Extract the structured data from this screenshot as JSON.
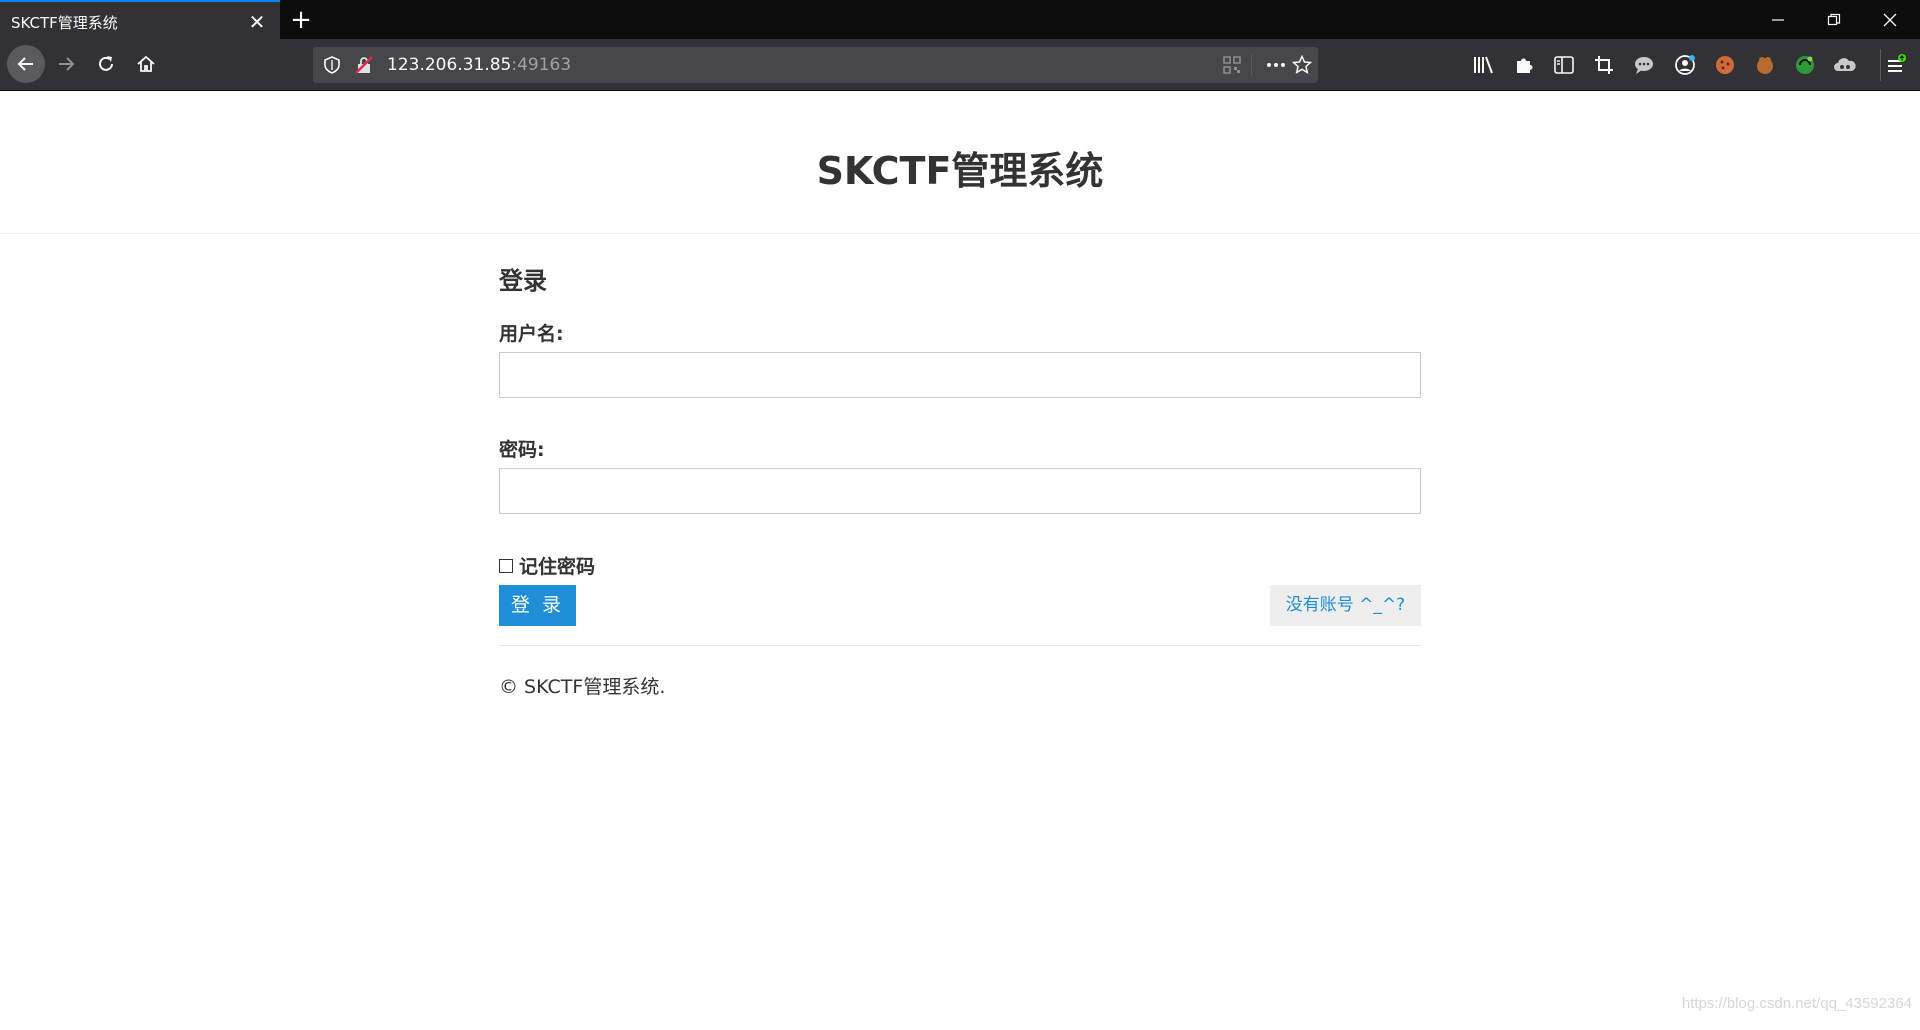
{
  "browser": {
    "tab_title": "SKCTF管理系统",
    "tab_close": "✕",
    "new_tab": "+",
    "url_host": "123.206.31.85",
    "url_port": ":49163"
  },
  "page": {
    "site_title": "SKCTF管理系统",
    "login_heading": "登录",
    "username_label": "用户名:",
    "username_value": "",
    "password_label": "密码:",
    "password_value": "",
    "remember_label": "记住密码",
    "remember_checked": false,
    "login_button": "登 录",
    "register_link": "没有账号 ^_^?",
    "footer": "© SKCTF管理系统."
  },
  "watermark": "https://blog.csdn.net/qq_43592364",
  "colors": {
    "accent": "#1e8fd6",
    "toolbar": "#323234",
    "tabbar": "#0c0c0d"
  }
}
